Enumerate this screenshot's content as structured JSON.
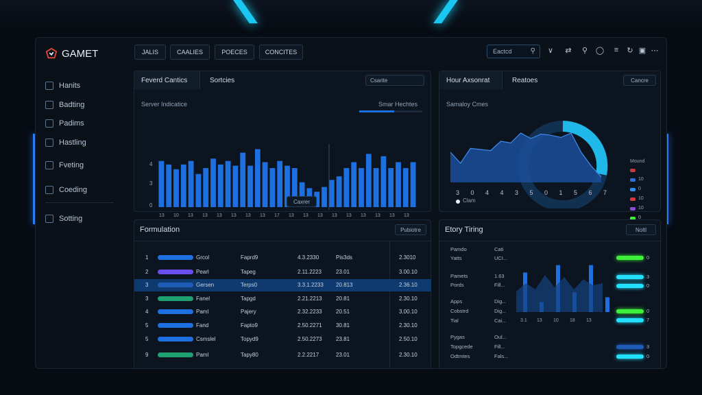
{
  "app": {
    "name": "GAMET"
  },
  "sidebar": {
    "items": [
      {
        "label": "Hanits",
        "icon": "chart-icon"
      },
      {
        "label": "Badting",
        "icon": "card-icon"
      },
      {
        "label": "Padims",
        "icon": "folder-icon"
      },
      {
        "label": "Hastling",
        "icon": "key-icon"
      },
      {
        "label": "Fveting",
        "icon": "globe-icon"
      },
      {
        "label": "Coeding",
        "icon": "cloud-icon"
      },
      {
        "label": "Sotting",
        "icon": "settings-icon"
      }
    ]
  },
  "topbar": {
    "tabs": [
      "JALIS",
      "CAALIES",
      "POECES",
      "CONCITES"
    ],
    "search_placeholder": "Eactcd"
  },
  "colors": {
    "accent": "#1e6fe0",
    "cyan": "#22e0ff",
    "green": "#3df03a",
    "bg": "#070b12"
  },
  "panel_left": {
    "tabs": [
      "Feverd Cantics",
      "Sortcies"
    ],
    "dropdown": "Csarite",
    "subtitle": "Server Indicatice",
    "legend": "Smar Hechtes",
    "button": "Caxrer",
    "chart_data": {
      "type": "bar",
      "categories": [
        "13",
        "10",
        "13",
        "13",
        "13",
        "13",
        "13",
        "13",
        "17",
        "13",
        "13",
        "13",
        "13",
        "13",
        "13",
        "13",
        "13",
        "13"
      ],
      "yticks": [
        "4",
        "3",
        "0"
      ],
      "values": [
        3.9,
        3.6,
        3.2,
        3.6,
        3.9,
        2.8,
        3.3,
        4.1,
        3.6,
        3.9,
        3.5,
        4.6,
        3.5,
        4.9,
        3.8,
        3.3,
        3.9,
        3.5,
        3.3,
        2.1,
        1.6,
        1.3,
        1.7,
        2.3,
        2.6,
        3.3,
        3.8,
        3.3,
        4.5,
        3.3,
        4.3,
        3.3,
        3.8,
        3.3,
        3.8
      ],
      "ylim": [
        0,
        6
      ]
    }
  },
  "panel_right": {
    "tabs": [
      "Hour Axsonrat",
      "Reatoes"
    ],
    "button": "Cancre",
    "subtitle": "Samaloy Cmes",
    "legend_title": "Mound",
    "legend_note": "Clam",
    "legend": [
      {
        "label": "",
        "color": "#c23a3a"
      },
      {
        "label": "10",
        "color": "#2d6fd6"
      },
      {
        "label": "0",
        "color": "#2d8cf0"
      },
      {
        "label": "10",
        "color": "#d43a3a"
      },
      {
        "label": "10",
        "color": "#8a4fd0"
      },
      {
        "label": "0",
        "color": "#3df03a"
      }
    ],
    "chart_data": {
      "type": "area",
      "x": [
        "3",
        "0",
        "4",
        "4",
        "3",
        "5",
        "0",
        "1",
        "5",
        "6",
        "7"
      ],
      "values": [
        0.55,
        0.35,
        0.62,
        0.6,
        0.58,
        0.75,
        0.72,
        0.9,
        0.8,
        0.88,
        0.86,
        0.82,
        0.9,
        0.55,
        0.3,
        0.1
      ],
      "ylim": [
        0,
        1
      ]
    }
  },
  "table": {
    "title": "Formulation",
    "button": "Pubiotre",
    "rows": [
      {
        "n": "1",
        "color": "#1e6fe0",
        "name": "Grcol",
        "type": "Faprd9",
        "date": "4.3.2330",
        "val": "Pis3ds",
        "amt": "2.3010"
      },
      {
        "n": "2",
        "color": "#6a4ff0",
        "name": "Pearl",
        "type": "Tapeg",
        "date": "2.11.2223",
        "val": "23.01",
        "amt": "3.00.10"
      },
      {
        "n": "3",
        "color": "#1e5bb5",
        "name": "Gersen",
        "type": "Terps0",
        "date": "3.3.1.2233",
        "val": "20.813",
        "amt": "2.36.10"
      },
      {
        "n": "3",
        "color": "#1fa070",
        "name": "Fanel",
        "type": "Tapgd",
        "date": "2.21.2213",
        "val": "20.81",
        "amt": "2.30.10"
      },
      {
        "n": "4",
        "color": "#1e6fe0",
        "name": "Paml",
        "type": "Pajery",
        "date": "2.32.2233",
        "val": "20.51",
        "amt": "3.00.10"
      },
      {
        "n": "5",
        "color": "#1e6fe0",
        "name": "Fand",
        "type": "Fapto9",
        "date": "2.50.2271",
        "val": "30.81",
        "amt": "2.30.10"
      },
      {
        "n": "5",
        "color": "#1e6fe0",
        "name": "Csmslel",
        "type": "Topyd9",
        "date": "2.50.2273",
        "val": "23.81",
        "amt": "2.50.10"
      },
      {
        "n": "9",
        "color": "#1fa070",
        "name": "Paml",
        "type": "Tapy80",
        "date": "2.2.2217",
        "val": "23.01",
        "amt": "2.30.10"
      }
    ]
  },
  "stats": {
    "title": "Etory Tiring",
    "button": "Noltl",
    "rows": [
      [
        "Pamdo",
        "Cati"
      ],
      [
        "Yatts",
        "UCI..."
      ],
      [
        "Pamets",
        "1.63"
      ],
      [
        "Pords",
        "Fill..."
      ],
      [
        "Apps",
        "Dig..."
      ],
      [
        "Cobstrd",
        "Dig..."
      ],
      [
        "Tial",
        "Cai..."
      ],
      [
        "Pygas",
        "Oul..."
      ],
      [
        "Topgcede",
        "Fill..."
      ],
      [
        "Odtmtes",
        "Fals..."
      ]
    ],
    "xticks": [
      "3.1",
      "13",
      "10",
      "18",
      "13"
    ],
    "bars": [
      0.8,
      0.2,
      0.95,
      0.4,
      0.95,
      0.3
    ],
    "line": [
      0.5,
      0.7,
      0.55,
      0.9,
      0.6,
      0.85,
      0.55,
      0.8,
      0.65,
      0.7
    ],
    "hbars": [
      {
        "color": "#3df03a",
        "label": "0"
      },
      {
        "color": "#22e0ff",
        "label": "3"
      },
      {
        "color": "#22e0ff",
        "label": "0"
      },
      {
        "color": "#3df03a",
        "label": "0"
      },
      {
        "color": "#22e0ff",
        "label": "7"
      },
      {
        "color": "#1e5bb5",
        "label": "3"
      },
      {
        "color": "#22e0ff",
        "label": "0"
      }
    ]
  }
}
